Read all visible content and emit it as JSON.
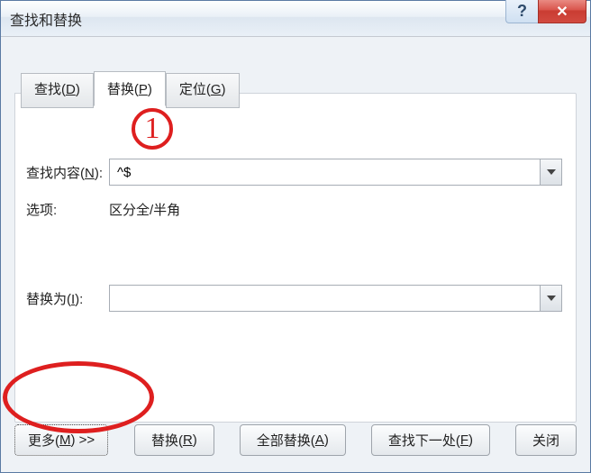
{
  "window": {
    "title": "查找和替换",
    "help_symbol": "?",
    "close_symbol": "✕"
  },
  "tabs": {
    "find": {
      "base": "查找(",
      "hotkey": "D",
      "tail": ")"
    },
    "replace": {
      "base": "替换(",
      "hotkey": "P",
      "tail": ")"
    },
    "goto": {
      "base": "定位(",
      "hotkey": "G",
      "tail": ")"
    }
  },
  "labels": {
    "find_content": {
      "base": "查找内容(",
      "hotkey": "N",
      "tail": "):"
    },
    "options": "选项:",
    "options_value": "区分全/半角",
    "replace_with": {
      "base": "替换为(",
      "hotkey": "I",
      "tail": "):"
    }
  },
  "inputs": {
    "find_value": "^$",
    "replace_value": ""
  },
  "buttons": {
    "more": {
      "base": "更多(",
      "hotkey": "M",
      "tail": ") >>"
    },
    "replace": {
      "base": "替换(",
      "hotkey": "R",
      "tail": ")"
    },
    "replace_all": {
      "base": "全部替换(",
      "hotkey": "A",
      "tail": ")"
    },
    "find_next": {
      "base": "查找下一处(",
      "hotkey": "F",
      "tail": ")"
    },
    "close": "关闭"
  },
  "annotations": {
    "circle1_text": "1"
  }
}
